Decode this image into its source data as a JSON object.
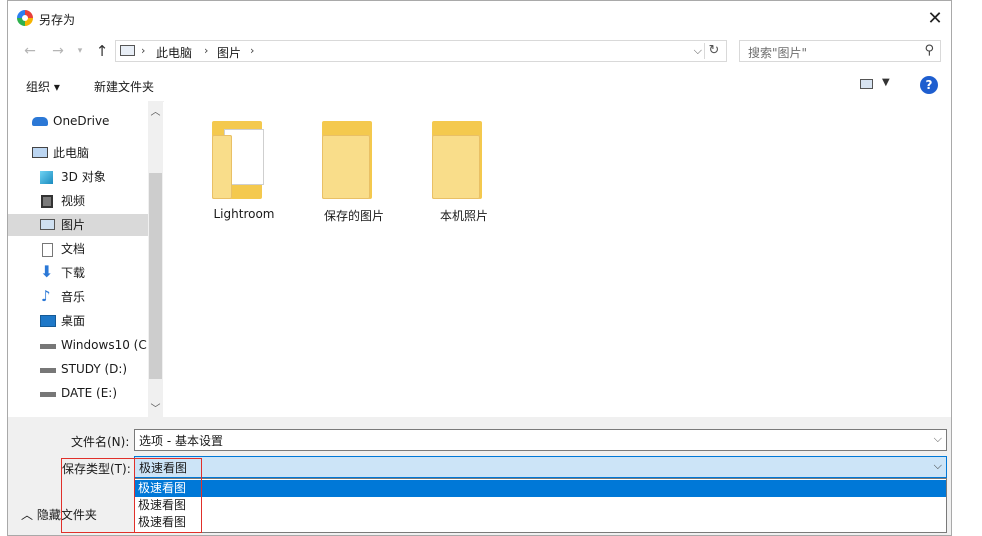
{
  "window": {
    "title": "另存为"
  },
  "address": {
    "crumbs": [
      "此电脑",
      "图片"
    ],
    "search_placeholder": "搜索\"图片\""
  },
  "toolbar": {
    "organize": "组织 ▾",
    "new_folder": "新建文件夹",
    "help": "?"
  },
  "sidebar": {
    "items": [
      {
        "label": "OneDrive",
        "icon": "cloud-icon"
      },
      {
        "label": "此电脑",
        "icon": "computer-icon"
      },
      {
        "label": "3D 对象",
        "icon": "cube-icon"
      },
      {
        "label": "视频",
        "icon": "film-icon"
      },
      {
        "label": "图片",
        "icon": "picture-icon",
        "selected": true
      },
      {
        "label": "文档",
        "icon": "document-icon"
      },
      {
        "label": "下载",
        "icon": "download-icon"
      },
      {
        "label": "音乐",
        "icon": "music-icon"
      },
      {
        "label": "桌面",
        "icon": "desktop-icon"
      },
      {
        "label": "Windows10 (C:",
        "icon": "drive-icon"
      },
      {
        "label": "STUDY (D:)",
        "icon": "drive-icon"
      },
      {
        "label": "DATE (E:)",
        "icon": "drive-icon"
      }
    ]
  },
  "folders": [
    {
      "name": "Lightroom",
      "has_content": true
    },
    {
      "name": "保存的图片",
      "has_content": false
    },
    {
      "name": "本机照片",
      "has_content": false
    }
  ],
  "form": {
    "filename_label": "文件名(N):",
    "filename_value": "选项 - 基本设置",
    "type_label": "保存类型(T):",
    "type_value": "极速看图",
    "type_options": [
      "极速看图",
      "极速看图",
      "极速看图"
    ],
    "hide_folders": "隐藏文件夹"
  },
  "colors": {
    "accent": "#0078d7",
    "folder": "#f4c94e",
    "highlight_box": "#e0302a"
  }
}
